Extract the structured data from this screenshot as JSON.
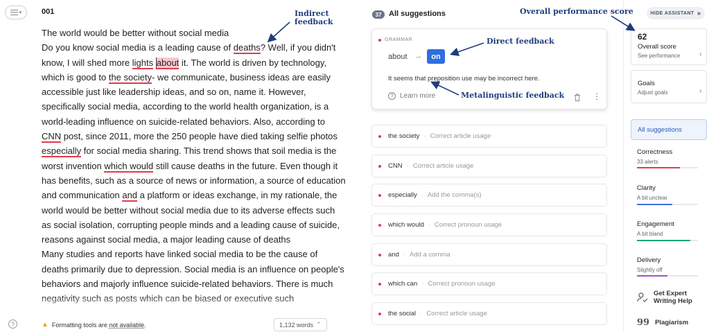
{
  "editor": {
    "doc_title": "001",
    "footer_warning_prefix": "Formatting tools are",
    "footer_warning_link": "not available",
    "footer_warning_suffix": ".",
    "word_count": "1,132 words",
    "chevron": "⌃"
  },
  "text": {
    "p1": "The world would be better without social media",
    "s1": "Do you know social media is a leading cause of ",
    "e1": "deaths",
    "s2": "? Well, if you didn't know, I will shed more ",
    "e2": "lights",
    "s3": " ",
    "e3": "about",
    "s4": " it. The world is driven by technology, which is good to ",
    "e4": "the society",
    "s5": "- we communicate, business ideas are easily accessible just like leadership ideas, and so on, name it. However, specifically social media, according to the world health organization, is a world-leading influence on suicide-related behaviors. Also, according to ",
    "e5": "CNN",
    "s6": " post, since 2011, more the 250 people have died taking selfie photos ",
    "e6": "especially",
    "s7": " for social media sharing. This trend shows that soil media is the worst invention ",
    "e7": "which would",
    "s8": " still cause deaths in the future.  Even though it has benefits, such as a source of news or information, a source of education and communication ",
    "e8": "and",
    "s9": " a platform or ideas exchange, in my rationale, the world would be better without social media due to its adverse effects such as social isolation, corrupting people minds and a leading cause of suicide, reasons against social media, a major leading cause of deaths",
    "p3": "Many studies and reports have linked social media to be the cause of deaths primarily due to depression. Social media is an influence on people's behaviors and majorly influence suicide-related behaviors. There is much negativity such as posts which can be biased or executive such"
  },
  "annotations": {
    "indirect": "Indirect feedback",
    "direct": "Direct feedback",
    "metalinguistic": "Metalinguistic feedback",
    "overall": "Overall performance score"
  },
  "suggestions_panel": {
    "count": "37",
    "title": "All suggestions",
    "active": {
      "category": "GRAMMAR",
      "original": "about",
      "arrow": "→",
      "replacement": "on",
      "explanation": "It seems that preposition use may be incorrect here.",
      "learn_more": "Learn more"
    },
    "items": [
      {
        "word": "the society",
        "type": "Correct article usage"
      },
      {
        "word": "CNN",
        "type": "Correct article usage"
      },
      {
        "word": "especially",
        "type": "Add the comma(s)"
      },
      {
        "word": "which would",
        "type": "Correct pronoun usage"
      },
      {
        "word": "and",
        "type": "Add a comma"
      },
      {
        "word": "which can",
        "type": "Correct pronoun usage"
      },
      {
        "word": "the social",
        "type": "Correct article usage"
      }
    ],
    "separator": "·"
  },
  "sidebar": {
    "hide_assistant": "HIDE ASSISTANT",
    "hide_chevron": "»",
    "score": "62",
    "score_label": "Overall score",
    "score_sub": "See performance",
    "goals_label": "Goals",
    "goals_sub": "Adjust goals",
    "chevron": "›",
    "all_suggestions": "All suggestions",
    "categories": [
      {
        "name": "Correctness",
        "sub": "33 alerts",
        "color": "#e23b4e",
        "fill": 0.7
      },
      {
        "name": "Clarity",
        "sub": "A bit unclear",
        "color": "#3f6fd8",
        "fill": 0.58
      },
      {
        "name": "Engagement",
        "sub": "A bit bland",
        "color": "#19a974",
        "fill": 0.88
      },
      {
        "name": "Delivery",
        "sub": "Slightly off",
        "color": "#9a55c9",
        "fill": 0.5
      }
    ],
    "expert_line1": "Get Expert",
    "expert_line2": "Writing Help",
    "plagiarism": "Plagiarism",
    "icons": {
      "expert": "person-check-icon",
      "plagiarism": "quote-icon"
    }
  },
  "colors": {
    "error_underline": "#e23b4e",
    "accent": "#2e6ee0",
    "annotation": "#1f3d7a"
  }
}
